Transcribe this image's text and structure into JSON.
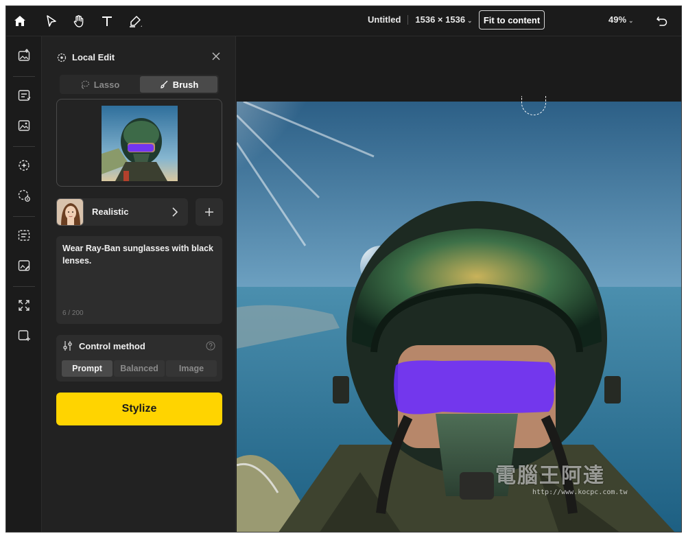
{
  "topbar": {
    "tools": [
      "home-icon",
      "pointer-icon",
      "hand-icon",
      "text-icon",
      "highlighter-icon"
    ],
    "doc_title": "Untitled",
    "doc_size": "1536 × 1536",
    "fit_label": "Fit to content",
    "zoom": "49%"
  },
  "rail": {
    "items": [
      "image-upload-icon",
      "text-edit-icon",
      "image-edit-icon",
      "magic-icon",
      "select-settings-icon",
      "image-text-icon",
      "image-brush-icon",
      "expand-icon",
      "image-plus-icon"
    ]
  },
  "panel": {
    "title": "Local Edit",
    "tabs": [
      {
        "label": "Lasso",
        "active": false
      },
      {
        "label": "Brush",
        "active": true
      }
    ],
    "style": {
      "label": "Realistic"
    },
    "prompt": {
      "text": "Wear Ray-Ban sunglasses with black lenses.",
      "count": "6 / 200"
    },
    "control": {
      "title": "Control method",
      "options": [
        {
          "label": "Prompt",
          "active": true
        },
        {
          "label": "Balanced",
          "active": false
        },
        {
          "label": "Image",
          "active": false
        }
      ]
    },
    "action_label": "Stylize"
  },
  "canvas": {
    "mask_color": "#6a2cff",
    "watermark": "電腦王阿達",
    "watermark_url": "http://www.kocpc.com.tw"
  },
  "colors": {
    "accent": "#ffd400",
    "background": "#1b1b1b",
    "panel": "#222222"
  }
}
